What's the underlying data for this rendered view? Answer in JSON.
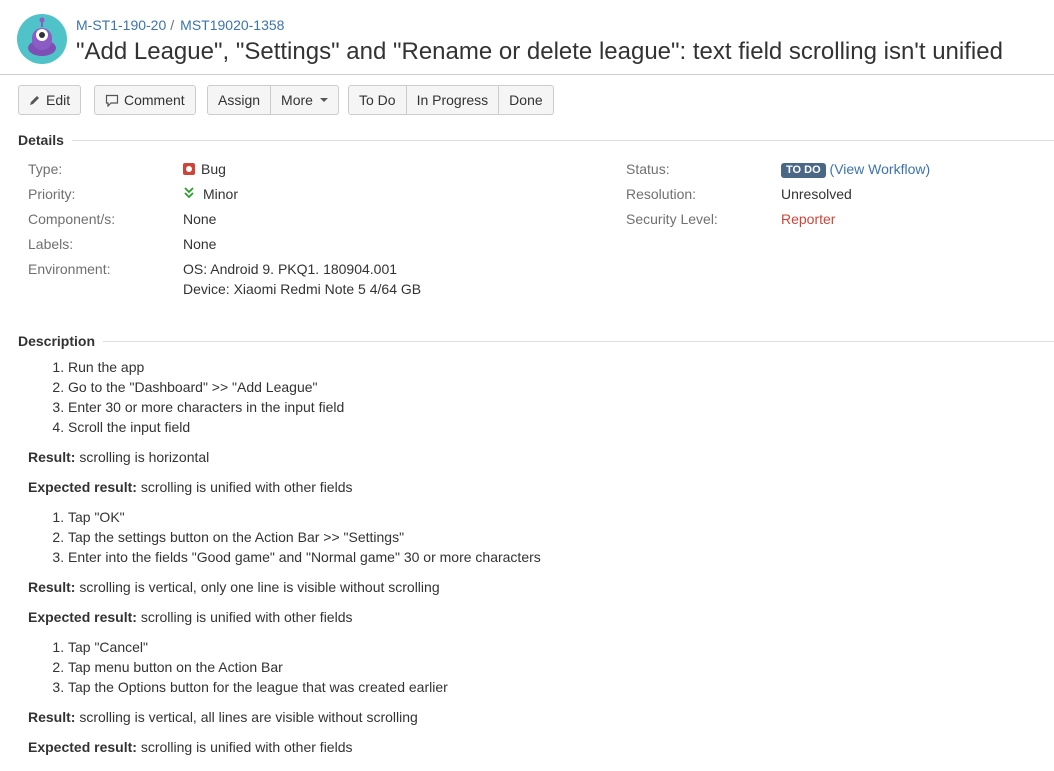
{
  "breadcrumb": {
    "project": "M-ST1-190-20",
    "separator": "/",
    "issue_key": "MST19020-1358"
  },
  "title": "\"Add League\", \"Settings\" and \"Rename or delete league\": text field scrolling isn't unified",
  "toolbar": {
    "edit": "Edit",
    "comment": "Comment",
    "assign": "Assign",
    "more": "More",
    "todo": "To Do",
    "in_progress": "In Progress",
    "done": "Done"
  },
  "details": {
    "heading": "Details",
    "type_label": "Type:",
    "type_value": "Bug",
    "priority_label": "Priority:",
    "priority_value": "Minor",
    "components_label": "Component/s:",
    "components_value": "None",
    "labels_label": "Labels:",
    "labels_value": "None",
    "environment_label": "Environment:",
    "environment_line1": "OS: Android 9. PKQ1. 180904.001",
    "environment_line2": "Device: Xiaomi Redmi Note 5 4/64 GB",
    "status_label": "Status:",
    "status_value": "TO DO",
    "view_workflow_open": "(",
    "view_workflow": "View Workflow",
    "view_workflow_close": ")",
    "resolution_label": "Resolution:",
    "resolution_value": "Unresolved",
    "security_label": "Security Level:",
    "security_value": "Reporter"
  },
  "description": {
    "heading": "Description",
    "result_label": "Result:",
    "expected_label": "Expected result:",
    "steps1": [
      "Run the app",
      "Go to the \"Dashboard\" >> \"Add League\"",
      "Enter 30 or more characters in the input field",
      "Scroll the input field"
    ],
    "result1": "scrolling is horizontal",
    "expected1": "scrolling is unified with other fields",
    "steps2": [
      "Tap \"OK\"",
      "Tap the settings button on the Action Bar >> \"Settings\"",
      "Enter into the fields \"Good game\" and \"Normal game\" 30 or more characters"
    ],
    "result2": "scrolling is vertical, only one line is visible without scrolling",
    "expected2": "scrolling is unified with other fields",
    "steps3": [
      "Tap \"Cancel\"",
      "Tap menu button on the Action Bar",
      "Tap the Options button for the league that was created earlier"
    ],
    "result3": "scrolling is vertical, all lines are visible without scrolling",
    "expected3": "scrolling is unified with other fields"
  },
  "colors": {
    "link": "#3b73af",
    "lozenge": "#4a6785",
    "bug": "#d04437",
    "priority": "#2c9f2c"
  }
}
